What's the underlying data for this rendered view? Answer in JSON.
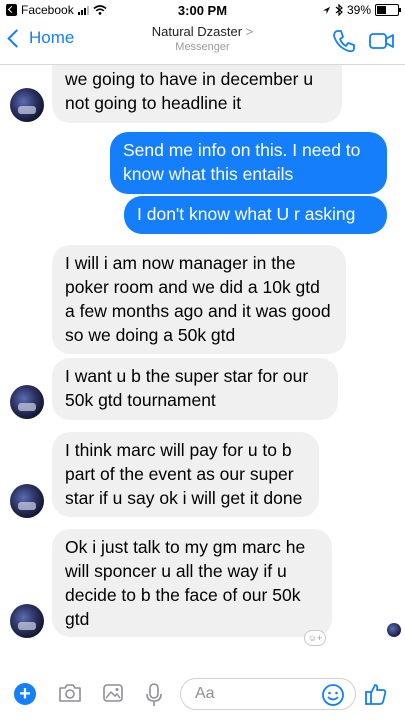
{
  "status_bar": {
    "back_app": "Facebook",
    "time": "3:00 PM",
    "battery": "39%"
  },
  "header": {
    "back_label": "Home",
    "contact_name": "Natural Dzaster",
    "chevron": ">",
    "subtitle": "Messenger"
  },
  "messages": [
    {
      "from": "them",
      "text": "we going to have in december u not going to headline it"
    },
    {
      "from": "me",
      "text": "Send me info on this. I need to know what this entails"
    },
    {
      "from": "me",
      "text": "I don't know what U r asking"
    },
    {
      "from": "them",
      "text": "I will i am now manager in the poker room and we did a 10k gtd a few months ago and it was good so we doing a 50k gtd"
    },
    {
      "from": "them",
      "text": "I want u b the super star for our 50k gtd tournament"
    },
    {
      "from": "them",
      "text": "I think marc will pay for u to b part of the event as our super star if u say ok i will get it done"
    },
    {
      "from": "them",
      "text": "Ok i just talk to my gm marc he will sponcer u all the way if u decide to b the face of our 50k gtd"
    }
  ],
  "composer": {
    "placeholder": "Aa"
  },
  "colors": {
    "accent": "#147efb",
    "incoming_bubble": "#f1f0f0"
  },
  "icons": [
    "back-chevron-icon",
    "phone-icon",
    "video-camera-icon",
    "plus-icon",
    "camera-icon",
    "gallery-icon",
    "microphone-icon",
    "emoji-icon",
    "thumbs-up-icon",
    "add-reaction-icon"
  ]
}
